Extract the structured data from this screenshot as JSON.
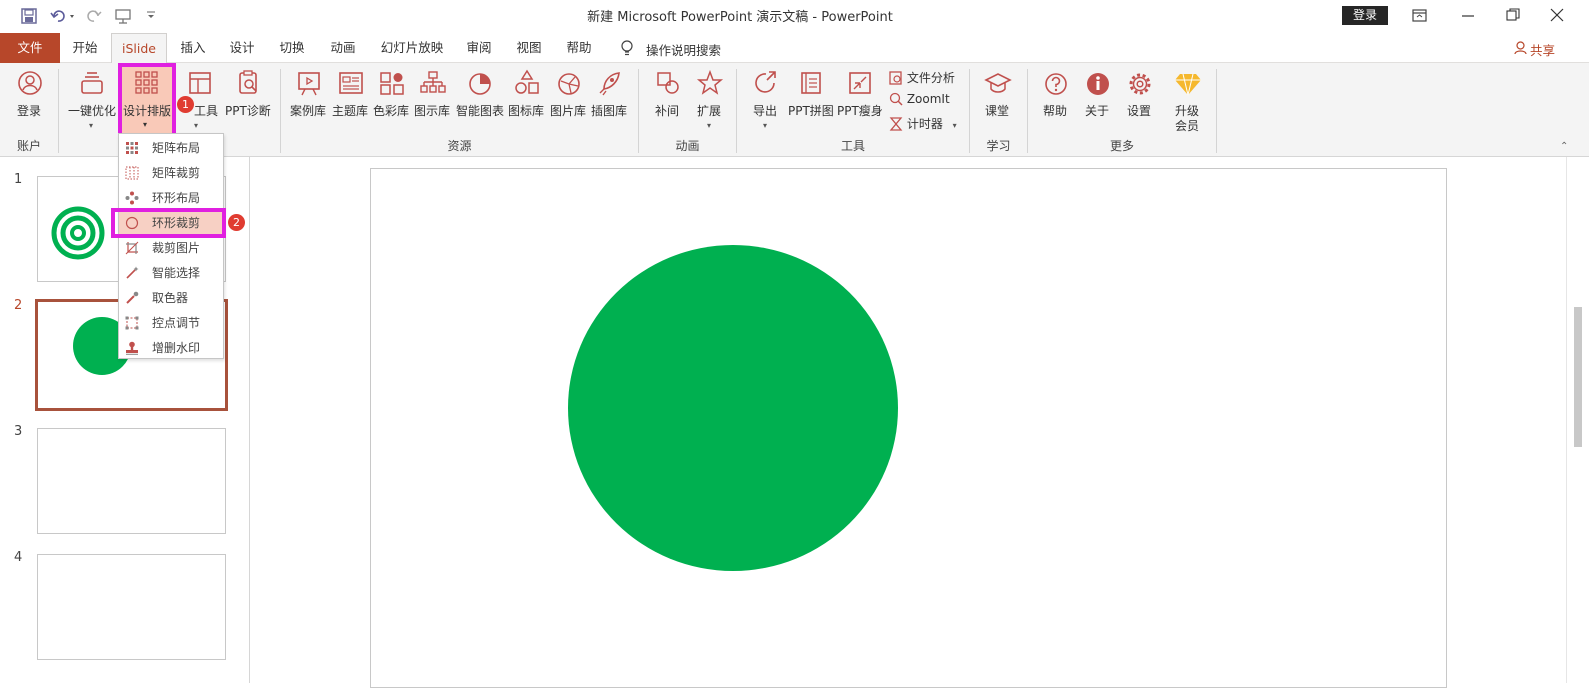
{
  "titlebar": {
    "title": "新建 Microsoft PowerPoint 演示文稿  -  PowerPoint",
    "login_button": "登录"
  },
  "tabs": [
    "文件",
    "开始",
    "iSlide",
    "插入",
    "设计",
    "切换",
    "动画",
    "幻灯片放映",
    "审阅",
    "视图",
    "帮助"
  ],
  "tell_me": "操作说明搜索",
  "share": "共享",
  "ribbon": {
    "account": {
      "login": "登录",
      "group": "账户"
    },
    "design": {
      "one_click": "一键优化",
      "layout": "设计排版",
      "tools": "工具",
      "ppt_diag": "PPT诊断"
    },
    "resources": {
      "items": [
        "案例库",
        "主题库",
        "色彩库",
        "图示库",
        "智能图表",
        "图标库",
        "图片库",
        "插图库"
      ],
      "group": "资源"
    },
    "animation": {
      "items": [
        "补间",
        "扩展"
      ],
      "group": "动画"
    },
    "tools": {
      "export": "导出",
      "ppt_collage": "PPT拼图",
      "ppt_slim": "PPT瘦身",
      "file_analysis": "文件分析",
      "zoomit": "ZoomIt",
      "timer": "计时器",
      "group": "工具"
    },
    "learn": {
      "class": "课堂",
      "group": "学习"
    },
    "more": {
      "help": "帮助",
      "about": "关于",
      "settings": "设置",
      "upgrade_1": "升级",
      "upgrade_2": "会员",
      "group": "更多"
    }
  },
  "dropdown": {
    "items": [
      "矩阵布局",
      "矩阵裁剪",
      "环形布局",
      "环形裁剪",
      "裁剪图片",
      "智能选择",
      "取色器",
      "控点调节",
      "增删水印"
    ]
  },
  "badges": [
    "1",
    "2"
  ],
  "slides": {
    "numbers": [
      "1",
      "2",
      "3",
      "4"
    ],
    "selected_index": 2
  },
  "colors": {
    "accent": "#b7472a",
    "circle_green": "#00b050",
    "highlight": "#e020e0",
    "badge_red": "#e03c31"
  }
}
